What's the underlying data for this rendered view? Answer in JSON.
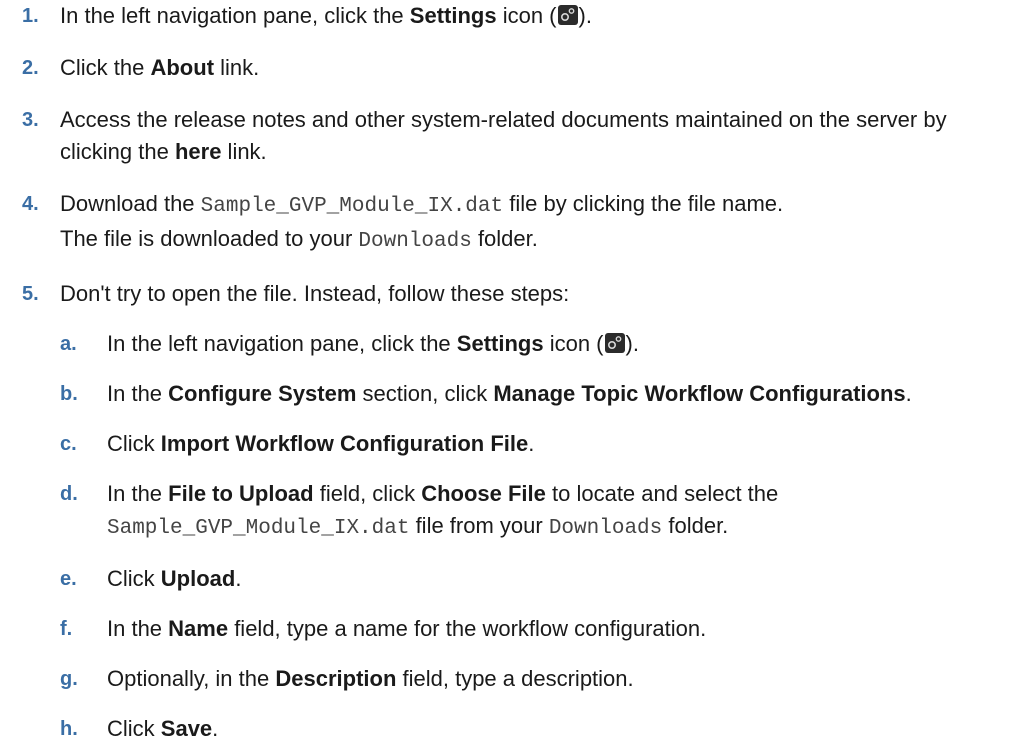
{
  "steps": [
    {
      "num": "1.",
      "t1": "In the left navigation pane, click the ",
      "b1": "Settings",
      "t2": " icon (",
      "t3": ")."
    },
    {
      "num": "2.",
      "t1": "Click the ",
      "b1": "About",
      "t2": " link."
    },
    {
      "num": "3.",
      "t1": "Access the release notes and other system-related documents maintained on the server by clicking the ",
      "b1": "here",
      "t2": " link."
    },
    {
      "num": "4.",
      "t1": "Download the ",
      "m1": "Sample_GVP_Module_IX.dat",
      "t2": " file by clicking the file name.",
      "t3": "The file is downloaded to your ",
      "m2": "Downloads",
      "t4": " folder."
    },
    {
      "num": "5.",
      "t1": "Don't try to open the file. Instead, follow these steps:"
    }
  ],
  "substeps": [
    {
      "num": "a.",
      "t1": "In the left navigation pane, click the ",
      "b1": "Settings",
      "t2": " icon (",
      "t3": ")."
    },
    {
      "num": "b.",
      "t1": "In the ",
      "b1": "Configure System",
      "t2": " section, click ",
      "b2": "Manage Topic Workflow Configurations",
      "t3": "."
    },
    {
      "num": "c.",
      "t1": "Click ",
      "b1": "Import Workflow Configuration File",
      "t2": "."
    },
    {
      "num": "d.",
      "t1": "In the ",
      "b1": "File to Upload",
      "t2": " field, click ",
      "b2": "Choose File",
      "t3": " to locate and select the ",
      "m1": "Sample_GVP_Module_IX.dat",
      "t4": " file from your ",
      "m2": "Downloads",
      "t5": " folder."
    },
    {
      "num": "e.",
      "t1": "Click ",
      "b1": "Upload",
      "t2": "."
    },
    {
      "num": "f.",
      "t1": "In the ",
      "b1": "Name",
      "t2": " field, type a name for the workflow configuration."
    },
    {
      "num": "g.",
      "t1": "Optionally, in the ",
      "b1": "Description",
      "t2": " field, type a description."
    },
    {
      "num": "h.",
      "t1": "Click ",
      "b1": "Save",
      "t2": "."
    }
  ]
}
